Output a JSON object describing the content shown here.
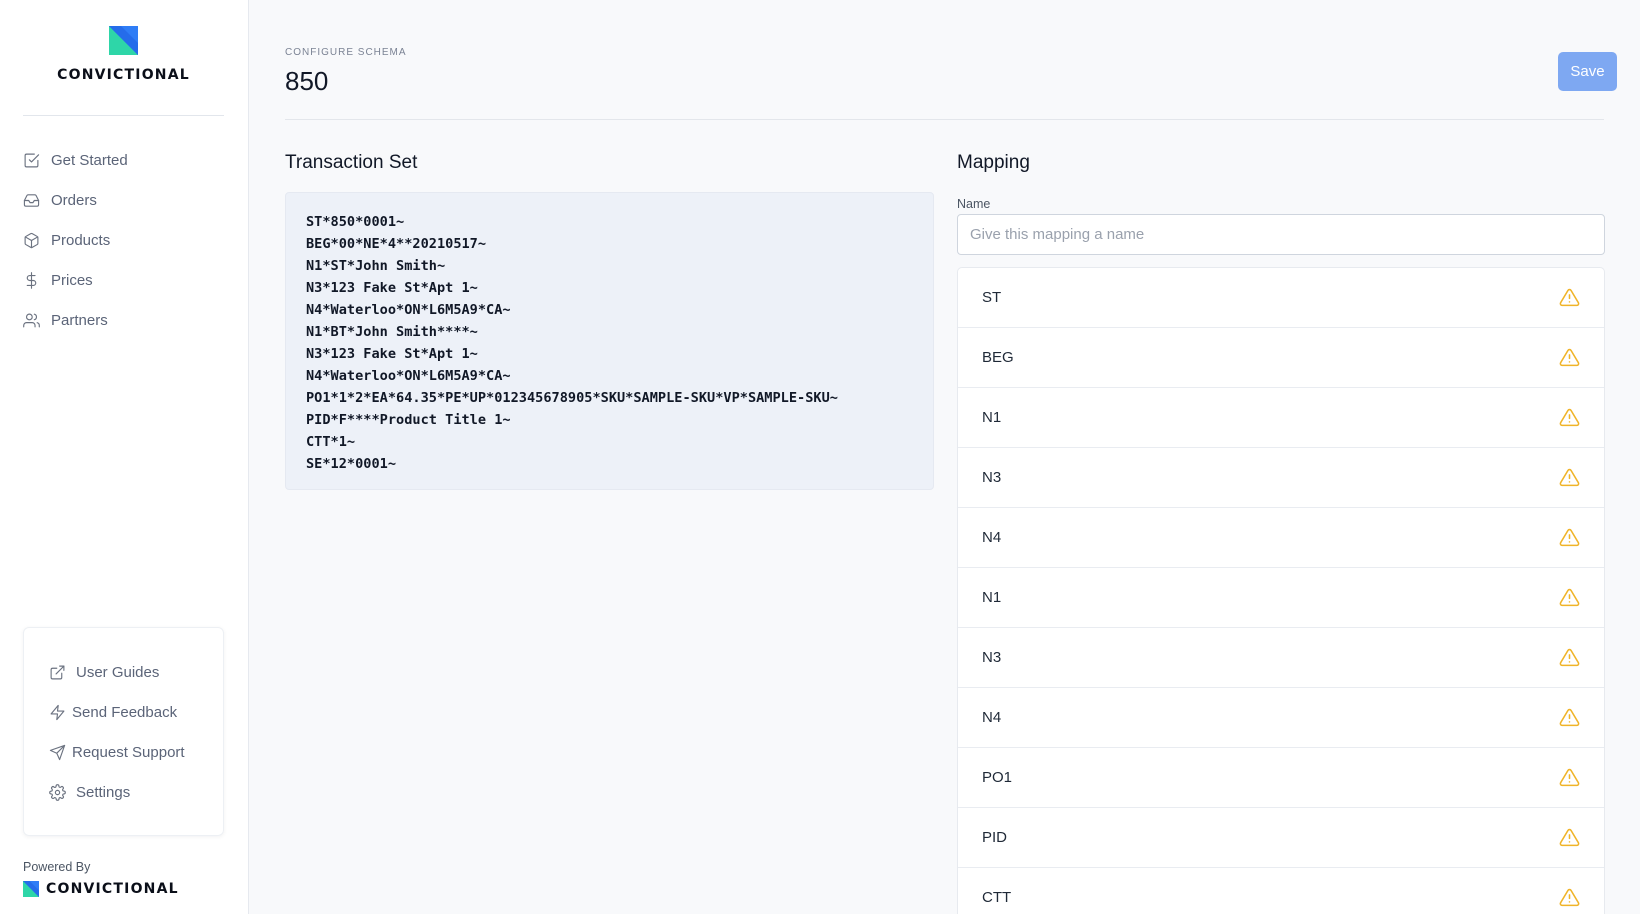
{
  "brand": {
    "name": "CONVICTIONAL",
    "powered_by": "Powered By",
    "colors": {
      "blue": "#2f7df6",
      "teal": "#2ed6a8"
    }
  },
  "sidebar": {
    "items": [
      {
        "label": "Get Started",
        "icon": "checkbox-icon"
      },
      {
        "label": "Orders",
        "icon": "inbox-icon"
      },
      {
        "label": "Products",
        "icon": "box-icon"
      },
      {
        "label": "Prices",
        "icon": "dollar-icon"
      },
      {
        "label": "Partners",
        "icon": "users-icon"
      }
    ],
    "help": [
      {
        "label": "User Guides",
        "icon": "external-link-icon"
      },
      {
        "label": "Send Feedback",
        "icon": "lightning-icon"
      },
      {
        "label": "Request Support",
        "icon": "send-icon"
      },
      {
        "label": "Settings",
        "icon": "gear-icon"
      }
    ]
  },
  "header": {
    "eyebrow": "CONFIGURE SCHEMA",
    "title": "850",
    "save_label": "Save",
    "save_color": "#7ea8f2"
  },
  "transaction": {
    "title": "Transaction Set",
    "lines": [
      "ST*850*0001~",
      "BEG*00*NE*4**20210517~",
      "N1*ST*John Smith~",
      "N3*123 Fake St*Apt 1~",
      "N4*Waterloo*ON*L6M5A9*CA~",
      "N1*BT*John Smith****~",
      "N3*123 Fake St*Apt 1~",
      "N4*Waterloo*ON*L6M5A9*CA~",
      "PO1*1*2*EA*64.35*PE*UP*012345678905*SKU*SAMPLE-SKU*VP*SAMPLE-SKU~",
      "PID*F****Product Title 1~",
      "CTT*1~",
      "SE*12*0001~"
    ]
  },
  "mapping": {
    "title": "Mapping",
    "name_label": "Name",
    "name_placeholder": "Give this mapping a name",
    "name_value": "",
    "warning_color": "#f0b429",
    "segments": [
      "ST",
      "BEG",
      "N1",
      "N3",
      "N4",
      "N1",
      "N3",
      "N4",
      "PO1",
      "PID",
      "CTT"
    ]
  }
}
